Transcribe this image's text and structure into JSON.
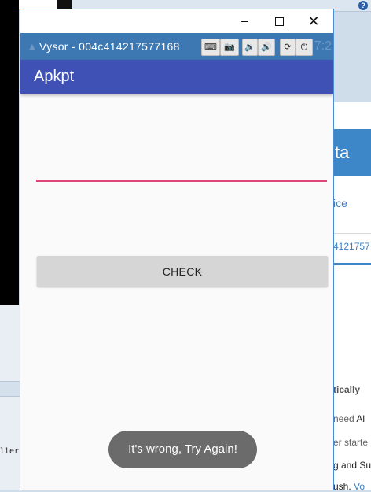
{
  "background": {
    "help_glyph": "?",
    "left_code_text": "ller",
    "right_header_text": "ta",
    "right_link_1": "ice",
    "right_link_2": "4121757",
    "right_texts": [
      {
        "text": "tically",
        "bold": true
      },
      {
        "text": "need ",
        "extra": "Al"
      },
      {
        "text": "er starte"
      },
      {
        "text": "g and Su"
      },
      {
        "text": "ush. ",
        "extra": "Vo"
      }
    ]
  },
  "window": {
    "min_label": "",
    "max_label": "",
    "close_label": "✕"
  },
  "vysor": {
    "title": "Vysor - 004c414217577168",
    "ghost_left": "▲",
    "ghost_right": "7:2",
    "buttons": {
      "keyboard": "⌨",
      "camera": "📷",
      "volume_down": "🔉",
      "volume_up": "🔊",
      "rotate": "⟳",
      "power": "⏻"
    }
  },
  "app": {
    "title": "Apkpt",
    "input_value": "",
    "input_placeholder": "",
    "check_label": "CHECK",
    "toast": "It's wrong, Try Again!"
  },
  "colors": {
    "app_bar": "#3f51b5",
    "vysor_bar": "#3e78b3",
    "input_underline": "#e0467c",
    "toast": "#6b6b6b"
  }
}
